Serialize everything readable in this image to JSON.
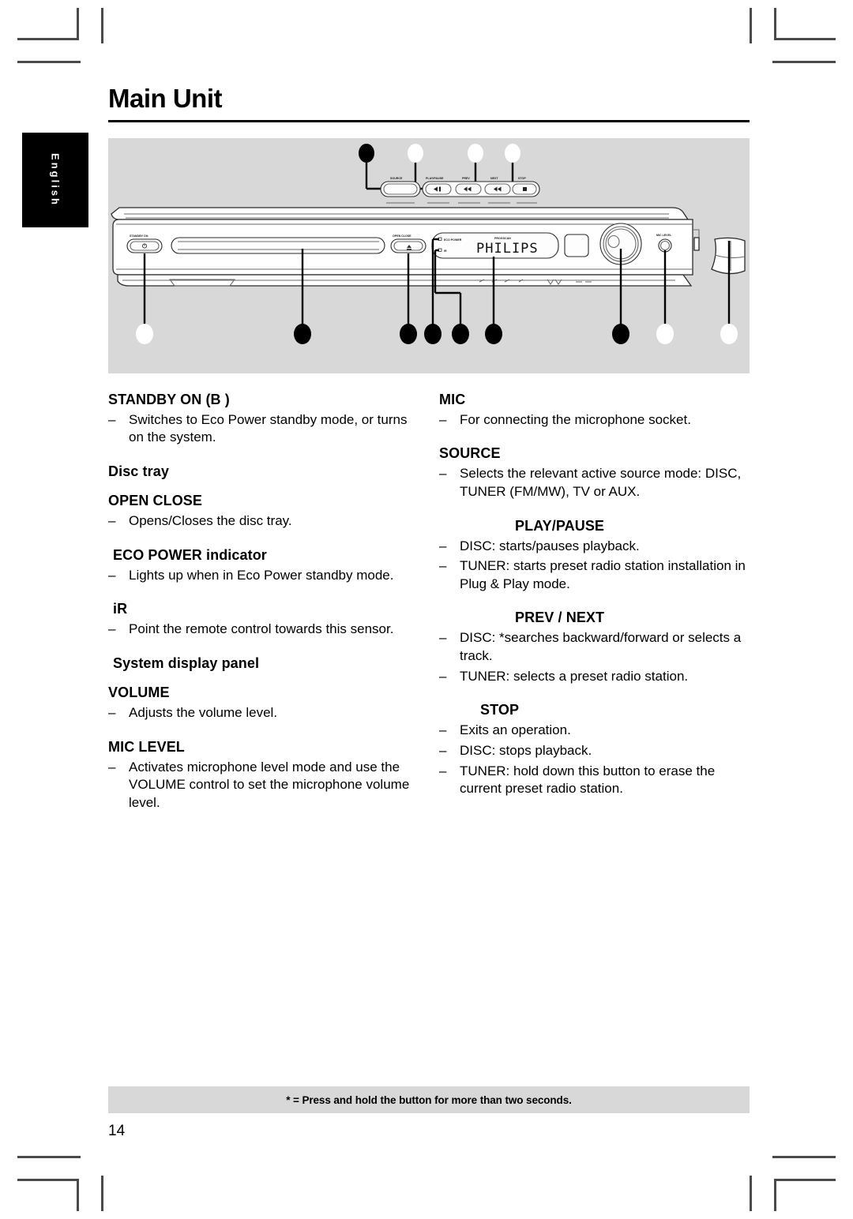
{
  "page": {
    "title": "Main Unit",
    "number": "14",
    "side_tab": "English",
    "footnote": "* = Press and hold the button for more than two seconds."
  },
  "illustration": {
    "brand": "PHILIPS",
    "labels": {
      "standby_on": "STANDBY ON",
      "open_close": "OPEN CLOSE",
      "eco_power": "ECO POWER",
      "ir": "iR",
      "progsc": "PROGSCAN",
      "mic_level": "MIC LEVEL",
      "source": "SOURCE",
      "play_pause": "PLAY/PAUSE",
      "prev": "PREV",
      "next": "NEXT",
      "stop": "STOP"
    }
  },
  "left_column": [
    {
      "heading": "STANDBY ON (B )",
      "indent": "none",
      "bullets": [
        "Switches to Eco Power standby mode, or turns on the system."
      ]
    },
    {
      "heading": "Disc tray",
      "indent": "none",
      "bullets": []
    },
    {
      "heading": "OPEN CLOSE",
      "indent": "none",
      "bullets": [
        "Opens/Closes the disc tray."
      ]
    },
    {
      "heading": "ECO POWER indicator",
      "indent": "small",
      "bullets": [
        "Lights up when in Eco Power standby mode."
      ]
    },
    {
      "heading": "iR",
      "indent": "small",
      "bullets": [
        "Point the remote control towards this sensor."
      ]
    },
    {
      "heading": "System display panel",
      "indent": "small",
      "bullets": []
    },
    {
      "heading": "VOLUME",
      "indent": "none",
      "bullets": [
        "Adjusts the volume level."
      ]
    },
    {
      "heading": "MIC LEVEL",
      "indent": "none",
      "bullets": [
        "Activates microphone level mode and use the VOLUME control to set the microphone volume level."
      ]
    }
  ],
  "right_column": [
    {
      "heading": "MIC",
      "indent": "none",
      "bullets": [
        "For connecting the microphone socket."
      ]
    },
    {
      "heading": "SOURCE",
      "indent": "none",
      "bullets": [
        "Selects the relevant active source mode: DISC, TUNER (FM/MW), TV or AUX."
      ]
    },
    {
      "heading": "PLAY/PAUSE",
      "indent": "large",
      "bullets": [
        "DISC: starts/pauses playback.",
        "TUNER: starts preset radio station installation in Plug & Play mode."
      ]
    },
    {
      "heading": "PREV / NEXT",
      "indent": "large",
      "bullets": [
        "DISC: *searches backward/forward or selects a track.",
        "TUNER: selects a preset radio station."
      ]
    },
    {
      "heading": "STOP",
      "indent": "medium",
      "bullets": [
        "Exits an operation.",
        "DISC: stops playback.",
        "TUNER: hold down this button to erase the current preset radio station."
      ]
    }
  ],
  "bullet_marker": "–",
  "colors": {
    "panel_gray": "#d8d8d8",
    "rule": "#000000",
    "tab_background": "#000000"
  }
}
